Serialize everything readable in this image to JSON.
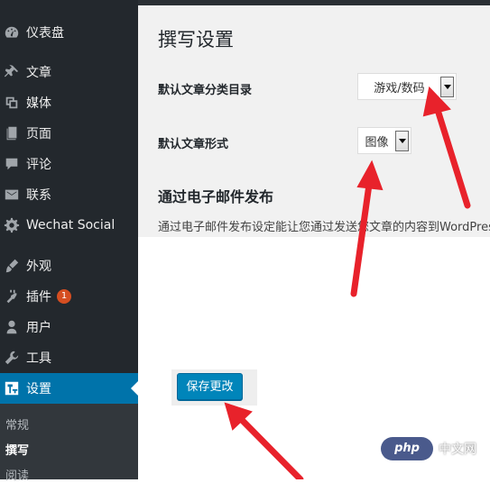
{
  "sidebar": {
    "items": [
      {
        "label": "仪表盘",
        "icon": "dashboard-icon"
      },
      {
        "label": "文章",
        "icon": "pin-icon"
      },
      {
        "label": "媒体",
        "icon": "media-icon"
      },
      {
        "label": "页面",
        "icon": "page-icon"
      },
      {
        "label": "评论",
        "icon": "comment-icon"
      },
      {
        "label": "联系",
        "icon": "mail-icon"
      },
      {
        "label": "Wechat Social",
        "icon": "gear-icon"
      },
      {
        "label": "外观",
        "icon": "brush-icon"
      },
      {
        "label": "插件",
        "icon": "plugin-icon",
        "badge": "1"
      },
      {
        "label": "用户",
        "icon": "user-icon"
      },
      {
        "label": "工具",
        "icon": "wrench-icon"
      },
      {
        "label": "设置",
        "icon": "settings-icon",
        "active": true
      }
    ],
    "submenu": [
      {
        "label": "常规"
      },
      {
        "label": "撰写",
        "current": true
      },
      {
        "label": "阅读"
      }
    ]
  },
  "main": {
    "title": "撰写设置",
    "default_category_label": "默认文章分类目录",
    "default_category_value": "游戏/数码",
    "default_format_label": "默认文章形式",
    "default_format_value": "图像",
    "email_section_title": "通过电子邮件发布",
    "email_description": "通过电子邮件发布设定能让您通过发送您文章的内容到WordPress"
  },
  "footer": {
    "save_label": "保存更改"
  },
  "watermark": {
    "logo": "php",
    "text": "中文网"
  },
  "colors": {
    "sidebar_bg": "#23282d",
    "active_bg": "#0073aa",
    "button_bg": "#0085ba",
    "annotation_red": "#e8222b"
  }
}
